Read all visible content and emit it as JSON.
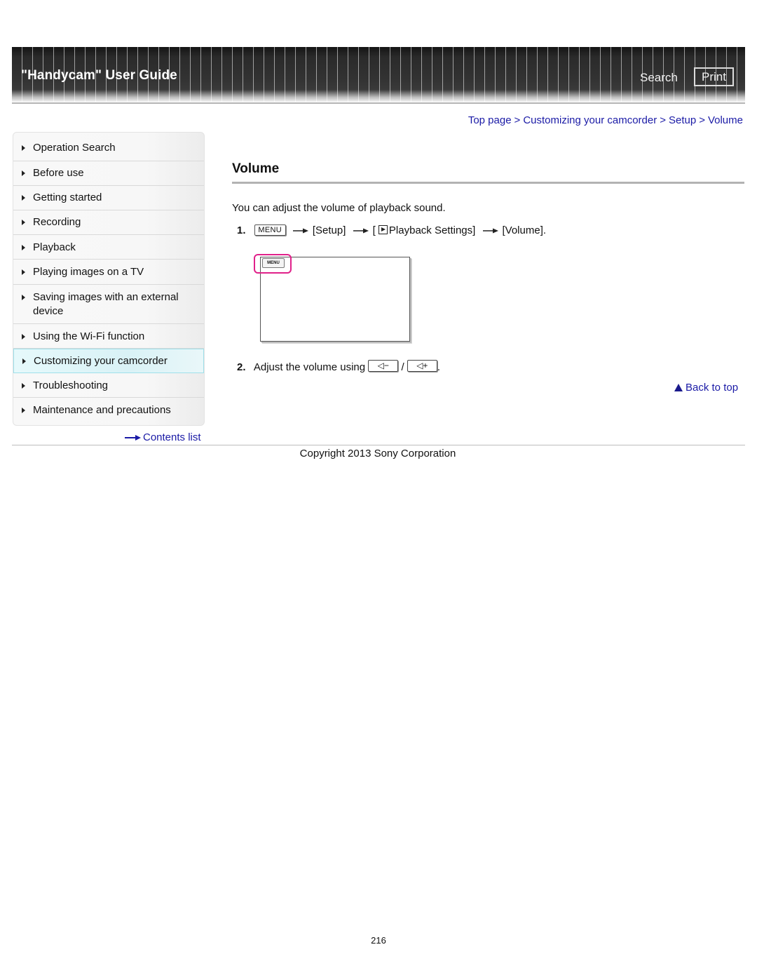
{
  "header": {
    "title": "\"Handycam\" User Guide",
    "search_label": "Search",
    "print_label": "Print"
  },
  "breadcrumb": {
    "items": [
      "Top page",
      "Customizing your camcorder",
      "Setup",
      "Volume"
    ],
    "separator": ">"
  },
  "sidebar": {
    "items": [
      {
        "label": "Operation Search"
      },
      {
        "label": "Before use"
      },
      {
        "label": "Getting started"
      },
      {
        "label": "Recording"
      },
      {
        "label": "Playback"
      },
      {
        "label": "Playing images on a TV"
      },
      {
        "label": "Saving images with an external device"
      },
      {
        "label": "Using the Wi-Fi function"
      },
      {
        "label": "Customizing your camcorder",
        "active": true
      },
      {
        "label": "Troubleshooting"
      },
      {
        "label": "Maintenance and precautions"
      }
    ],
    "contents_link": "Contents list"
  },
  "main": {
    "title": "Volume",
    "intro": "You can adjust the volume of playback sound.",
    "step1": {
      "num": "1.",
      "menu_key": "MENU",
      "setup": "[Setup]",
      "bracket_open": "[",
      "playback_settings": "Playback Settings]",
      "volume": "[Volume]."
    },
    "figure": {
      "menu_button": "MENU"
    },
    "step2": {
      "num": "2.",
      "text": "Adjust the volume using",
      "vol_down": "◁−",
      "slash": "/",
      "vol_up": "◁+",
      "end": "."
    },
    "back_to_top": "Back to top"
  },
  "footer": {
    "copyright": "Copyright 2013 Sony Corporation",
    "page_number": "216"
  },
  "colors": {
    "link": "#1a1aa6",
    "highlight_ring": "#e0218a",
    "active_nav_bg": "#d9f2f6"
  }
}
